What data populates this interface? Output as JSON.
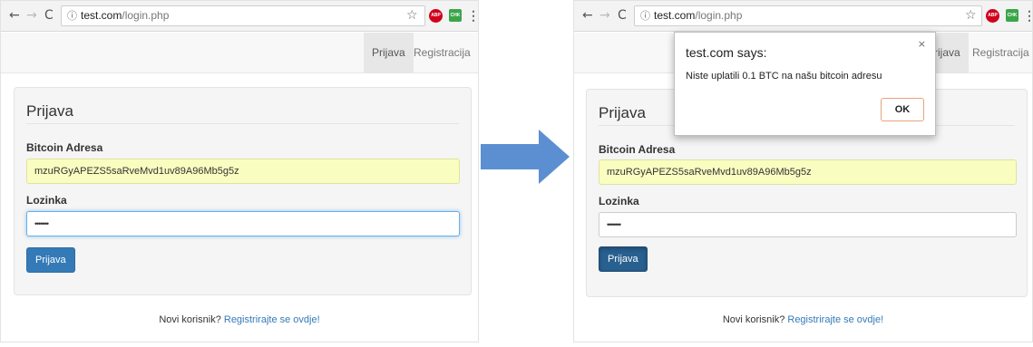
{
  "left": {
    "url_host": "test.com",
    "url_path": "/login.php",
    "nav": {
      "login": "Prijava",
      "register": "Registracija"
    },
    "panel_title": "Prijava",
    "address_label": "Bitcoin Adresa",
    "address_value": "mzuRGyAPEZS5saRveMvd1uv89A96Mb5g5z",
    "password_label": "Lozinka",
    "password_value": "•••••••",
    "submit_label": "Prijava",
    "footer_text": "Novi korisnik?",
    "footer_link": "Registrirajte se ovdje!"
  },
  "right": {
    "url_host": "test.com",
    "url_path": "/login.php",
    "nav": {
      "login": "rijava",
      "register": "Registracija"
    },
    "panel_title": "Prijava",
    "address_label": "Bitcoin Adresa",
    "address_value": "mzuRGyAPEZS5saRveMvd1uv89A96Mb5g5z",
    "password_label": "Lozinka",
    "password_value": "•••••••",
    "submit_label": "Prijava",
    "footer_text": "Novi korisnik?",
    "footer_link": "Registrirajte se ovdje!",
    "alert": {
      "title": "test.com says:",
      "message": "Niste uplatili 0.1 BTC na našu bitcoin adresu",
      "ok_label": "OK",
      "close_glyph": "×"
    }
  },
  "chrome": {
    "back": "←",
    "forward": "→",
    "reload": "C",
    "info": "ⓘ",
    "star": "☆",
    "abp": "ABP",
    "ext": "CHK",
    "menu": "⋮"
  },
  "colors": {
    "arrow": "#5b8fd1",
    "primary_button": "#337ab7",
    "autofill_bg": "#fafdc0",
    "link": "#337ab7"
  },
  "icons": {
    "back": "arrow-left-icon",
    "forward": "arrow-right-icon",
    "reload": "reload-icon",
    "info": "info-icon",
    "star": "star-icon",
    "adblock": "adblock-icon",
    "extension": "extension-icon",
    "menu": "kebab-menu-icon",
    "transition": "transition-arrow-icon"
  }
}
